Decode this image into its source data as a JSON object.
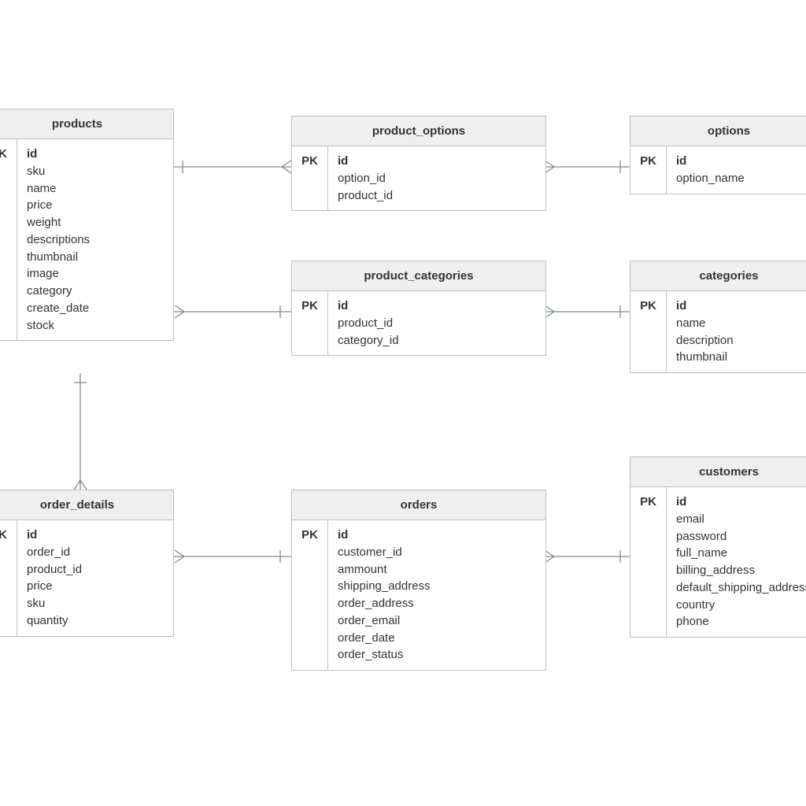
{
  "pk_label": "PK",
  "entities": {
    "products": {
      "title": "products",
      "fields": [
        "id",
        "sku",
        "name",
        "price",
        "weight",
        "descriptions",
        "thumbnail",
        "image",
        "category",
        "create_date",
        "stock"
      ]
    },
    "product_options": {
      "title": "product_options",
      "fields": [
        "id",
        "option_id",
        "product_id"
      ]
    },
    "options": {
      "title": "options",
      "fields": [
        "id",
        "option_name"
      ]
    },
    "product_categories": {
      "title": "product_categories",
      "fields": [
        "id",
        "product_id",
        "category_id"
      ]
    },
    "categories": {
      "title": "categories",
      "fields": [
        "id",
        "name",
        "description",
        "thumbnail"
      ]
    },
    "order_details": {
      "title": "order_details",
      "fields": [
        "id",
        "order_id",
        "product_id",
        "price",
        "sku",
        "quantity"
      ]
    },
    "orders": {
      "title": "orders",
      "fields": [
        "id",
        "customer_id",
        "ammount",
        "shipping_address",
        "order_address",
        "order_email",
        "order_date",
        "order_status"
      ]
    },
    "customers": {
      "title": "customers",
      "fields": [
        "id",
        "email",
        "password",
        "full_name",
        "billing_address",
        "default_shipping_address",
        "country",
        "phone"
      ]
    }
  }
}
